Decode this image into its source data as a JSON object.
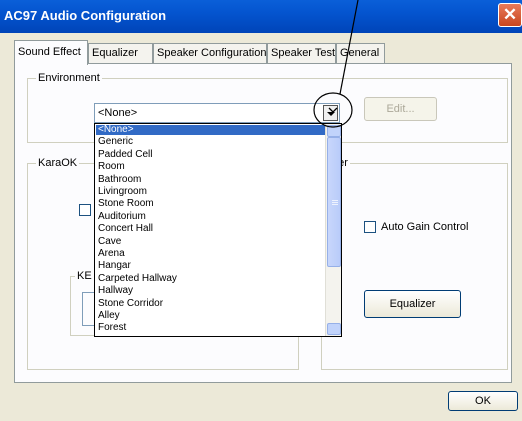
{
  "window": {
    "title": "AC97 Audio Configuration",
    "close_glyph": "✕"
  },
  "tabs": [
    {
      "label": "Sound Effect"
    },
    {
      "label": "Equalizer"
    },
    {
      "label": "Speaker Configuration"
    },
    {
      "label": "Speaker Test"
    },
    {
      "label": "General"
    }
  ],
  "environment": {
    "group_label": "Environment",
    "selected_value": "<None>",
    "edit_button": "Edit...",
    "options": [
      "<None>",
      "Generic",
      "Padded Cell",
      "Room",
      "Bathroom",
      "Livingroom",
      "Stone Room",
      "Auditorium",
      "Concert Hall",
      "Cave",
      "Arena",
      "Hangar",
      "Carpeted Hallway",
      "Hallway",
      "Stone Corridor",
      "Alley",
      "Forest"
    ]
  },
  "karaok": {
    "group_label": "KaraOK",
    "sub_label": "KE"
  },
  "other_group": {
    "label_fragment": "her"
  },
  "auto_gain": {
    "label": "Auto Gain Control",
    "checked": false
  },
  "equalizer_button": "Equalizer",
  "ok_button": "OK",
  "colors": {
    "titlebar": "#0454cf",
    "selection": "#316ac5",
    "face": "#ece9d8"
  },
  "icons": {
    "dropdown_arrow": "chevron-down-icon",
    "scroll_up": "scroll-up-icon",
    "scroll_down": "scroll-down-icon"
  }
}
